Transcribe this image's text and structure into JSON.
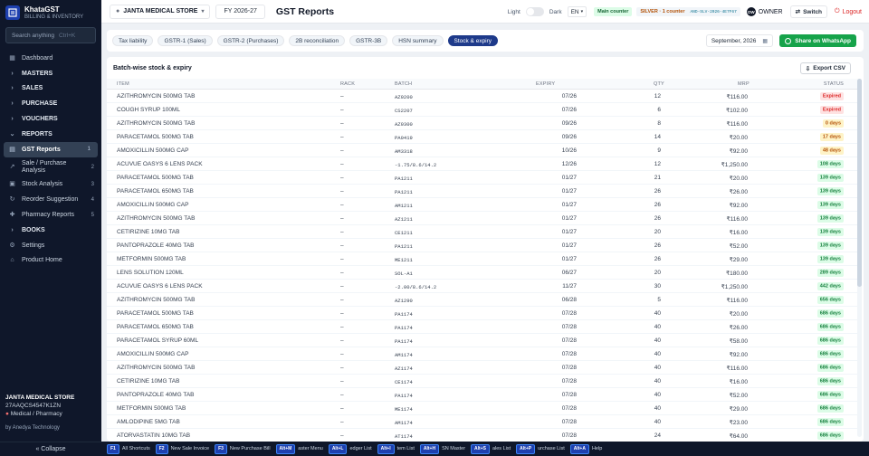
{
  "brand": {
    "name": "KhataGST",
    "subtitle": "BILLING & INVENTORY"
  },
  "search": {
    "placeholder": "Search anything",
    "shortcut": "Ctrl+K"
  },
  "sidebar": {
    "items": [
      {
        "label": "Dashboard",
        "icon": "grid-icon"
      },
      {
        "label": "MASTERS",
        "icon": "chevron-right-icon"
      },
      {
        "label": "SALES",
        "icon": "chevron-right-icon"
      },
      {
        "label": "PURCHASE",
        "icon": "chevron-right-icon"
      },
      {
        "label": "VOUCHERS",
        "icon": "chevron-right-icon"
      },
      {
        "label": "REPORTS",
        "icon": "chevron-down-icon"
      },
      {
        "label": "GST Reports",
        "icon": "file-icon",
        "count": "1"
      },
      {
        "label": "Sale / Purchase Analysis",
        "icon": "chart-icon",
        "count": "2"
      },
      {
        "label": "Stock Analysis",
        "icon": "box-icon",
        "count": "3"
      },
      {
        "label": "Reorder Suggestion",
        "icon": "refresh-icon",
        "count": "4"
      },
      {
        "label": "Pharmacy Reports",
        "icon": "pill-icon",
        "count": "5"
      },
      {
        "label": "BOOKS",
        "icon": "chevron-right-icon"
      },
      {
        "label": "Settings",
        "icon": "gear-icon"
      },
      {
        "label": "Product Home",
        "icon": "home-icon"
      }
    ],
    "footer": {
      "store": "JANTA MEDICAL STORE",
      "gstin": "27AAQCS4547K1ZN",
      "type": "Medical / Pharmacy",
      "by": "by Anedya Technology"
    },
    "collapse_label": "« Collapse"
  },
  "topbar": {
    "store": "JANTA MEDICAL STORE",
    "fy": "FY 2026-27",
    "title": "GST Reports",
    "light": "Light",
    "dark": "Dark",
    "lang": "EN",
    "counter": "Main counter",
    "plan": "SILVER · 1 counter",
    "license": "AND-SLV-2026-4E7F67",
    "avatar": "OW",
    "role": "OWNER",
    "switch": "Switch",
    "logout": "Logout"
  },
  "tabs": [
    {
      "label": "Tax liability",
      "active": false
    },
    {
      "label": "GSTR-1 (Sales)",
      "active": false
    },
    {
      "label": "GSTR-2 (Purchases)",
      "active": false
    },
    {
      "label": "2B reconciliation",
      "active": false
    },
    {
      "label": "GSTR-3B",
      "active": false
    },
    {
      "label": "HSN summary",
      "active": false
    },
    {
      "label": "Stock & expiry",
      "active": true
    }
  ],
  "month": "September, 2026",
  "whatsapp_label": "Share on WhatsApp",
  "card": {
    "title": "Batch-wise stock & expiry",
    "export_label": "Export CSV",
    "columns": {
      "item": "ITEM",
      "rack": "RACK",
      "batch": "BATCH",
      "expiry": "EXPIRY",
      "qty": "QTY",
      "mrp": "MRP",
      "status": "STATUS"
    }
  },
  "rows": [
    {
      "item": "AZITHROMYCIN 500MG TAB",
      "rack": "–",
      "batch": "AZ9200",
      "expiry": "07/26",
      "qty": "12",
      "mrp": "₹116.00",
      "status": "Expired",
      "tone": "red"
    },
    {
      "item": "COUGH SYRUP 100ML",
      "rack": "–",
      "batch": "CS2207",
      "expiry": "07/26",
      "qty": "6",
      "mrp": "₹102.00",
      "status": "Expired",
      "tone": "red"
    },
    {
      "item": "AZITHROMYCIN 500MG TAB",
      "rack": "–",
      "batch": "AZ9300",
      "expiry": "09/26",
      "qty": "8",
      "mrp": "₹116.00",
      "status": "0 days",
      "tone": "amber"
    },
    {
      "item": "PARACETAMOL 500MG TAB",
      "rack": "–",
      "batch": "PA0419",
      "expiry": "09/26",
      "qty": "14",
      "mrp": "₹20.00",
      "status": "17 days",
      "tone": "amber"
    },
    {
      "item": "AMOXICILLIN 500MG CAP",
      "rack": "–",
      "batch": "AM3318",
      "expiry": "10/26",
      "qty": "9",
      "mrp": "₹92.00",
      "status": "48 days",
      "tone": "amber"
    },
    {
      "item": "ACUVUE OASYS 6 LENS PACK",
      "rack": "–",
      "batch": "-1.75/8.6/14.2",
      "expiry": "12/26",
      "qty": "12",
      "mrp": "₹1,250.00",
      "status": "108 days",
      "tone": "green"
    },
    {
      "item": "PARACETAMOL 500MG TAB",
      "rack": "–",
      "batch": "PA1211",
      "expiry": "01/27",
      "qty": "21",
      "mrp": "₹20.00",
      "status": "139 days",
      "tone": "green"
    },
    {
      "item": "PARACETAMOL 650MG TAB",
      "rack": "–",
      "batch": "PA1211",
      "expiry": "01/27",
      "qty": "26",
      "mrp": "₹26.00",
      "status": "139 days",
      "tone": "green"
    },
    {
      "item": "AMOXICILLIN 500MG CAP",
      "rack": "–",
      "batch": "AM1211",
      "expiry": "01/27",
      "qty": "26",
      "mrp": "₹92.00",
      "status": "139 days",
      "tone": "green"
    },
    {
      "item": "AZITHROMYCIN 500MG TAB",
      "rack": "–",
      "batch": "AZ1211",
      "expiry": "01/27",
      "qty": "26",
      "mrp": "₹116.00",
      "status": "139 days",
      "tone": "green"
    },
    {
      "item": "CETIRIZINE 10MG TAB",
      "rack": "–",
      "batch": "CE1211",
      "expiry": "01/27",
      "qty": "20",
      "mrp": "₹16.00",
      "status": "139 days",
      "tone": "green"
    },
    {
      "item": "PANTOPRAZOLE 40MG TAB",
      "rack": "–",
      "batch": "PA1211",
      "expiry": "01/27",
      "qty": "26",
      "mrp": "₹52.00",
      "status": "139 days",
      "tone": "green"
    },
    {
      "item": "METFORMIN 500MG TAB",
      "rack": "–",
      "batch": "ME1211",
      "expiry": "01/27",
      "qty": "26",
      "mrp": "₹29.00",
      "status": "139 days",
      "tone": "green"
    },
    {
      "item": "LENS SOLUTION 120ML",
      "rack": "–",
      "batch": "SOL-A1",
      "expiry": "06/27",
      "qty": "20",
      "mrp": "₹180.00",
      "status": "289 days",
      "tone": "green"
    },
    {
      "item": "ACUVUE OASYS 6 LENS PACK",
      "rack": "–",
      "batch": "-2.00/8.6/14.2",
      "expiry": "11/27",
      "qty": "30",
      "mrp": "₹1,250.00",
      "status": "442 days",
      "tone": "green"
    },
    {
      "item": "AZITHROMYCIN 500MG TAB",
      "rack": "–",
      "batch": "AZ1290",
      "expiry": "06/28",
      "qty": "5",
      "mrp": "₹116.00",
      "status": "656 days",
      "tone": "green"
    },
    {
      "item": "PARACETAMOL 500MG TAB",
      "rack": "–",
      "batch": "PA1174",
      "expiry": "07/28",
      "qty": "40",
      "mrp": "₹20.00",
      "status": "686 days",
      "tone": "green"
    },
    {
      "item": "PARACETAMOL 650MG TAB",
      "rack": "–",
      "batch": "PA1174",
      "expiry": "07/28",
      "qty": "40",
      "mrp": "₹26.00",
      "status": "686 days",
      "tone": "green"
    },
    {
      "item": "PARACETAMOL SYRUP 60ML",
      "rack": "–",
      "batch": "PA1174",
      "expiry": "07/28",
      "qty": "40",
      "mrp": "₹58.00",
      "status": "686 days",
      "tone": "green"
    },
    {
      "item": "AMOXICILLIN 500MG CAP",
      "rack": "–",
      "batch": "AM1174",
      "expiry": "07/28",
      "qty": "40",
      "mrp": "₹92.00",
      "status": "686 days",
      "tone": "green"
    },
    {
      "item": "AZITHROMYCIN 500MG TAB",
      "rack": "–",
      "batch": "AZ1174",
      "expiry": "07/28",
      "qty": "40",
      "mrp": "₹116.00",
      "status": "686 days",
      "tone": "green"
    },
    {
      "item": "CETIRIZINE 10MG TAB",
      "rack": "–",
      "batch": "CE1174",
      "expiry": "07/28",
      "qty": "40",
      "mrp": "₹16.00",
      "status": "686 days",
      "tone": "green"
    },
    {
      "item": "PANTOPRAZOLE 40MG TAB",
      "rack": "–",
      "batch": "PA1174",
      "expiry": "07/28",
      "qty": "40",
      "mrp": "₹52.00",
      "status": "686 days",
      "tone": "green"
    },
    {
      "item": "METFORMIN 500MG TAB",
      "rack": "–",
      "batch": "ME1174",
      "expiry": "07/28",
      "qty": "40",
      "mrp": "₹29.00",
      "status": "686 days",
      "tone": "green"
    },
    {
      "item": "AMLODIPINE 5MG TAB",
      "rack": "–",
      "batch": "AM1174",
      "expiry": "07/28",
      "qty": "40",
      "mrp": "₹23.00",
      "status": "686 days",
      "tone": "green"
    },
    {
      "item": "ATORVASTATIN 10MG TAB",
      "rack": "–",
      "batch": "AT1174",
      "expiry": "07/28",
      "qty": "24",
      "mrp": "₹64.00",
      "status": "686 days",
      "tone": "green"
    }
  ],
  "shortcuts": [
    {
      "key": "F1",
      "label": "All Shortcuts"
    },
    {
      "key": "F2",
      "label": "New Sale Invoice"
    },
    {
      "key": "F3",
      "label": "New Purchase Bill"
    },
    {
      "key": "Alt+M",
      "label": "aster Menu"
    },
    {
      "key": "Alt+L",
      "label": "edger List"
    },
    {
      "key": "Alt+I",
      "label": "tem List"
    },
    {
      "key": "Alt+H",
      "label": "SN Master"
    },
    {
      "key": "Alt+S",
      "label": "ales List"
    },
    {
      "key": "Alt+P",
      "label": "urchase List"
    },
    {
      "key": "Alt+A",
      "label": "Help"
    }
  ]
}
